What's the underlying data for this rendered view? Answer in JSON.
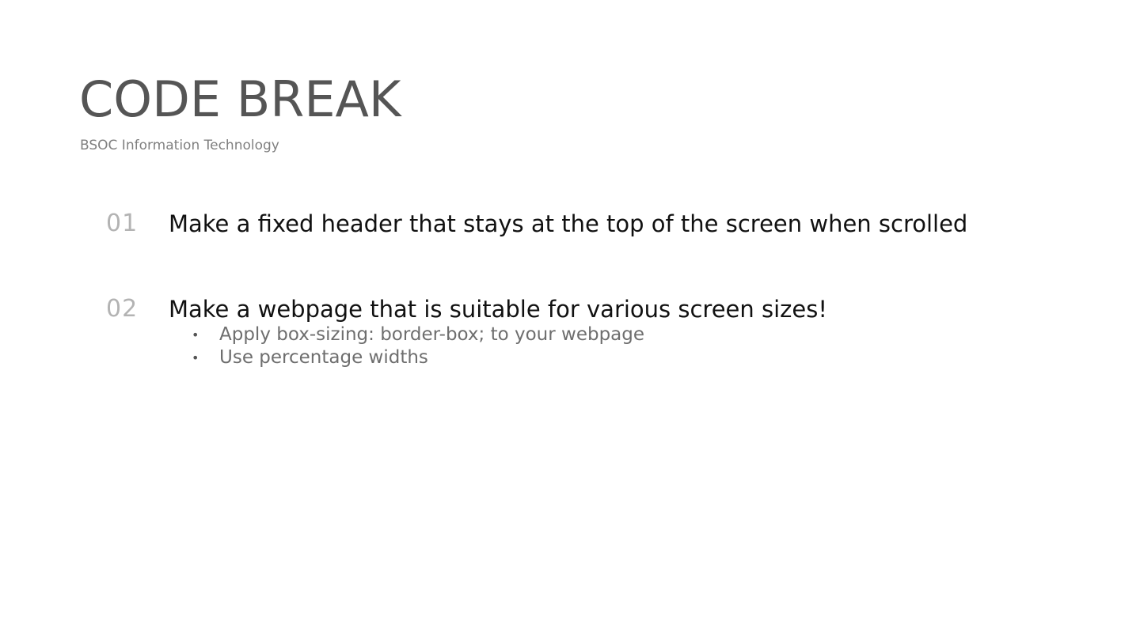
{
  "slide": {
    "title": "CODE BREAK",
    "subtitle": "BSOC Information Technology",
    "items": [
      {
        "number": "01",
        "text": "Make a fixed header that stays at the top of the screen when scrolled",
        "bullets": []
      },
      {
        "number": "02",
        "text": "Make a webpage that is suitable for various screen sizes!",
        "bullets": [
          "Apply box-sizing: border-box; to your webpage",
          "Use percentage widths"
        ]
      }
    ],
    "bullet_glyph": "•"
  }
}
